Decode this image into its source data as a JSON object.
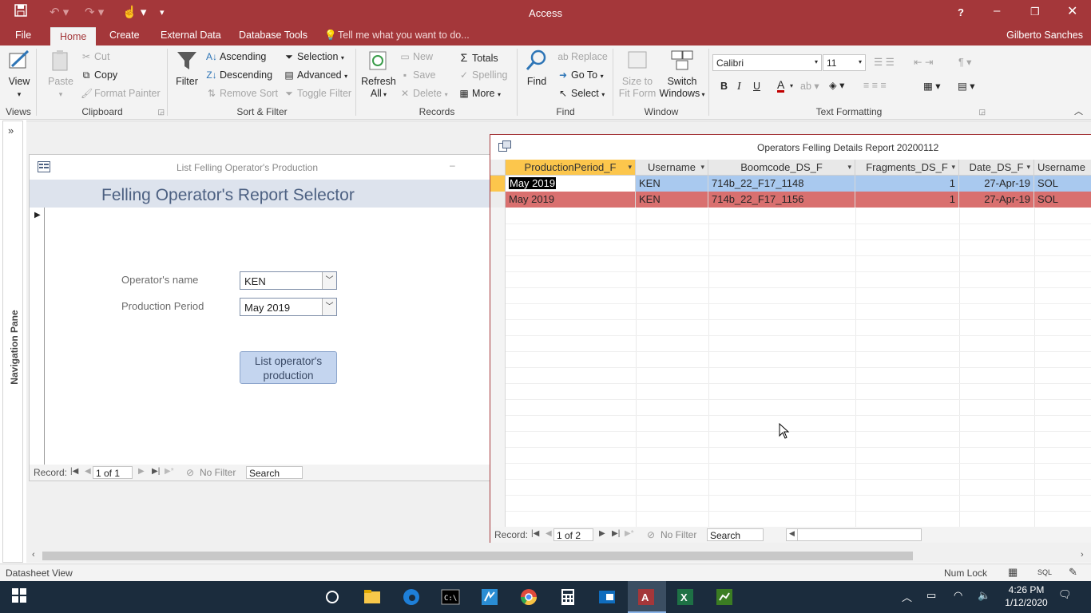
{
  "app": {
    "title": "Access",
    "user": "Gilberto Sanches",
    "help_label": "?"
  },
  "tabs": [
    "File",
    "Home",
    "Create",
    "External Data",
    "Database Tools"
  ],
  "tell_me": "Tell me what you want to do...",
  "ribbon": {
    "views": {
      "label": "Views",
      "view": "View"
    },
    "clipboard": {
      "label": "Clipboard",
      "paste": "Paste",
      "cut": "Cut",
      "copy": "Copy",
      "format_painter": "Format Painter"
    },
    "sort_filter": {
      "label": "Sort & Filter",
      "filter": "Filter",
      "ascending": "Ascending",
      "descending": "Descending",
      "remove_sort": "Remove Sort",
      "selection": "Selection",
      "advanced": "Advanced",
      "toggle_filter": "Toggle Filter"
    },
    "records": {
      "label": "Records",
      "refresh": "Refresh",
      "refresh2": "All",
      "new": "New",
      "save": "Save",
      "delete": "Delete",
      "totals": "Totals",
      "spelling": "Spelling",
      "more": "More"
    },
    "find": {
      "label": "Find",
      "find": "Find",
      "replace": "Replace",
      "goto": "Go To",
      "select": "Select"
    },
    "window": {
      "label": "Window",
      "size_fit": "Size to",
      "size_fit2": "Fit Form",
      "switch": "Switch",
      "switch2": "Windows"
    },
    "text_formatting": {
      "label": "Text Formatting",
      "font": "Calibri",
      "size": "11",
      "bold": "B",
      "italic": "I",
      "underline": "U",
      "font_color_letter": "A"
    }
  },
  "navigation_pane": {
    "label": "Navigation Pane"
  },
  "form": {
    "window_title": "List Felling Operator's Production",
    "heading": "Felling Operator's Report Selector",
    "operator_label": "Operator's name",
    "operator_value": "KEN",
    "period_label": "Production Period",
    "period_value": "May 2019",
    "list_button_line1": "List operator's",
    "list_button_line2": "production",
    "nav": {
      "record_label": "Record:",
      "position": "1 of 1",
      "filter": "No Filter",
      "search": "Search"
    }
  },
  "datasheet": {
    "window_title": "Operators Felling Details Report 20200112",
    "columns": [
      "ProductionPeriod_F",
      "Username",
      "Boomcode_DS_F",
      "Fragments_DS_F",
      "Date_DS_F",
      "Username"
    ],
    "rows": [
      [
        "May 2019",
        "KEN",
        "714b_22_F17_1148",
        "1",
        "27-Apr-19",
        "SOL"
      ],
      [
        "May 2019",
        "KEN",
        "714b_22_F17_1156",
        "1",
        "27-Apr-19",
        "SOL"
      ]
    ],
    "nav": {
      "record_label": "Record:",
      "position": "1 of 2",
      "filter": "No Filter",
      "search": "Search"
    }
  },
  "status": {
    "left": "Datasheet View",
    "num_lock": "Num Lock",
    "sql": "SQL"
  },
  "clock": {
    "time": "4:26 PM",
    "date": "1/12/2020"
  },
  "colors": {
    "access_red": "#a4373a",
    "header_selected": "#fcc64c",
    "row_selected": "#a9c9ef",
    "row_current": "#d9706f"
  }
}
